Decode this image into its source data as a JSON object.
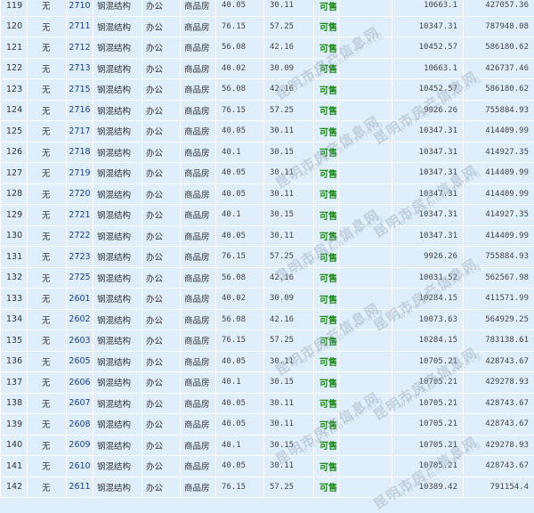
{
  "rows": [
    {
      "seq": "119",
      "layer": "无",
      "room": "2710",
      "structure": "钢混结构",
      "use": "办公",
      "type": "商品房",
      "area1": "40.05",
      "area2": "30.11",
      "status": "可售",
      "price": "10663.1",
      "total": "427057.36"
    },
    {
      "seq": "120",
      "layer": "无",
      "room": "2711",
      "structure": "钢混结构",
      "use": "办公",
      "type": "商品房",
      "area1": "76.15",
      "area2": "57.25",
      "status": "可售",
      "price": "10347.31",
      "total": "787948.08"
    },
    {
      "seq": "121",
      "layer": "无",
      "room": "2712",
      "structure": "钢混结构",
      "use": "办公",
      "type": "商品房",
      "area1": "56.08",
      "area2": "42.16",
      "status": "可售",
      "price": "10452.57",
      "total": "586180.62"
    },
    {
      "seq": "122",
      "layer": "无",
      "room": "2713",
      "structure": "钢混结构",
      "use": "办公",
      "type": "商品房",
      "area1": "40.02",
      "area2": "30.09",
      "status": "可售",
      "price": "10663.1",
      "total": "426737.46"
    },
    {
      "seq": "123",
      "layer": "无",
      "room": "2715",
      "structure": "钢混结构",
      "use": "办公",
      "type": "商品房",
      "area1": "56.08",
      "area2": "42.16",
      "status": "可售",
      "price": "10452.57",
      "total": "586180.62"
    },
    {
      "seq": "124",
      "layer": "无",
      "room": "2716",
      "structure": "钢混结构",
      "use": "办公",
      "type": "商品房",
      "area1": "76.15",
      "area2": "57.25",
      "status": "可售",
      "price": "9926.26",
      "total": "755884.93"
    },
    {
      "seq": "125",
      "layer": "无",
      "room": "2717",
      "structure": "钢混结构",
      "use": "办公",
      "type": "商品房",
      "area1": "40.05",
      "area2": "30.11",
      "status": "可售",
      "price": "10347.31",
      "total": "414409.99"
    },
    {
      "seq": "126",
      "layer": "无",
      "room": "2718",
      "structure": "钢混结构",
      "use": "办公",
      "type": "商品房",
      "area1": "40.1",
      "area2": "30.15",
      "status": "可售",
      "price": "10347.31",
      "total": "414927.35"
    },
    {
      "seq": "127",
      "layer": "无",
      "room": "2719",
      "structure": "钢混结构",
      "use": "办公",
      "type": "商品房",
      "area1": "40.05",
      "area2": "30.11",
      "status": "可售",
      "price": "10347.31",
      "total": "414409.99"
    },
    {
      "seq": "128",
      "layer": "无",
      "room": "2720",
      "structure": "钢混结构",
      "use": "办公",
      "type": "商品房",
      "area1": "40.05",
      "area2": "30.11",
      "status": "可售",
      "price": "10347.31",
      "total": "414409.99"
    },
    {
      "seq": "129",
      "layer": "无",
      "room": "2721",
      "structure": "钢混结构",
      "use": "办公",
      "type": "商品房",
      "area1": "40.1",
      "area2": "30.15",
      "status": "可售",
      "price": "10347.31",
      "total": "414927.35"
    },
    {
      "seq": "130",
      "layer": "无",
      "room": "2722",
      "structure": "钢混结构",
      "use": "办公",
      "type": "商品房",
      "area1": "40.05",
      "area2": "30.11",
      "status": "可售",
      "price": "10347.31",
      "total": "414409.99"
    },
    {
      "seq": "131",
      "layer": "无",
      "room": "2723",
      "structure": "钢混结构",
      "use": "办公",
      "type": "商品房",
      "area1": "76.15",
      "area2": "57.25",
      "status": "可售",
      "price": "9926.26",
      "total": "755884.93"
    },
    {
      "seq": "132",
      "layer": "无",
      "room": "2725",
      "structure": "钢混结构",
      "use": "办公",
      "type": "商品房",
      "area1": "56.08",
      "area2": "42.16",
      "status": "可售",
      "price": "10031.52",
      "total": "562567.98"
    },
    {
      "seq": "133",
      "layer": "无",
      "room": "2601",
      "structure": "钢混结构",
      "use": "办公",
      "type": "商品房",
      "area1": "40.02",
      "area2": "30.09",
      "status": "可售",
      "price": "10284.15",
      "total": "411571.99"
    },
    {
      "seq": "134",
      "layer": "无",
      "room": "2602",
      "structure": "钢混结构",
      "use": "办公",
      "type": "商品房",
      "area1": "56.08",
      "area2": "42.16",
      "status": "可售",
      "price": "10073.63",
      "total": "564929.25"
    },
    {
      "seq": "135",
      "layer": "无",
      "room": "2603",
      "structure": "钢混结构",
      "use": "办公",
      "type": "商品房",
      "area1": "76.15",
      "area2": "57.25",
      "status": "可售",
      "price": "10284.15",
      "total": "783138.61"
    },
    {
      "seq": "136",
      "layer": "无",
      "room": "2605",
      "structure": "钢混结构",
      "use": "办公",
      "type": "商品房",
      "area1": "40.05",
      "area2": "30.11",
      "status": "可售",
      "price": "10705.21",
      "total": "428743.67"
    },
    {
      "seq": "137",
      "layer": "无",
      "room": "2606",
      "structure": "钢混结构",
      "use": "办公",
      "type": "商品房",
      "area1": "40.1",
      "area2": "30.15",
      "status": "可售",
      "price": "10705.21",
      "total": "429278.93"
    },
    {
      "seq": "138",
      "layer": "无",
      "room": "2607",
      "structure": "钢混结构",
      "use": "办公",
      "type": "商品房",
      "area1": "40.05",
      "area2": "30.11",
      "status": "可售",
      "price": "10705.21",
      "total": "428743.67"
    },
    {
      "seq": "139",
      "layer": "无",
      "room": "2608",
      "structure": "钢混结构",
      "use": "办公",
      "type": "商品房",
      "area1": "40.05",
      "area2": "30.11",
      "status": "可售",
      "price": "10705.21",
      "total": "428743.67"
    },
    {
      "seq": "140",
      "layer": "无",
      "room": "2609",
      "structure": "钢混结构",
      "use": "办公",
      "type": "商品房",
      "area1": "40.1",
      "area2": "30.15",
      "status": "可售",
      "price": "10705.21",
      "total": "429278.93"
    },
    {
      "seq": "141",
      "layer": "无",
      "room": "2610",
      "structure": "钢混结构",
      "use": "办公",
      "type": "商品房",
      "area1": "40.05",
      "area2": "30.11",
      "status": "可售",
      "price": "10705.21",
      "total": "428743.67"
    },
    {
      "seq": "142",
      "layer": "无",
      "room": "2611",
      "structure": "钢混结构",
      "use": "办公",
      "type": "商品房",
      "area1": "76.15",
      "area2": "57.25",
      "status": "可售",
      "price": "10389.42",
      "total": "791154.4"
    }
  ],
  "watermark": {
    "cn": "昆明市房产信息网",
    "url": "www.kmhouse.org"
  }
}
